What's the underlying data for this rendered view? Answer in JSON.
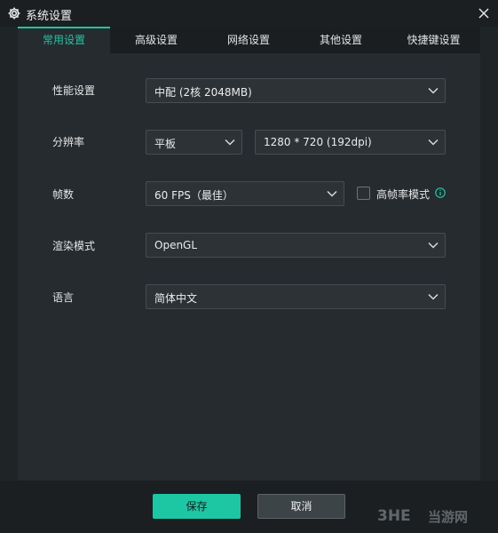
{
  "window": {
    "title": "系统设置",
    "icon": "gear-icon",
    "close_icon": "close-icon"
  },
  "tabs": [
    {
      "label": "常用设置",
      "active": true
    },
    {
      "label": "高级设置",
      "active": false
    },
    {
      "label": "网络设置",
      "active": false
    },
    {
      "label": "其他设置",
      "active": false
    },
    {
      "label": "快捷键设置",
      "active": false
    }
  ],
  "settings": {
    "performance": {
      "label": "性能设置",
      "value": "中配 (2核 2048MB)"
    },
    "resolution": {
      "label": "分辨率",
      "device": "平板",
      "value": "1280 * 720 (192dpi)"
    },
    "fps": {
      "label": "帧数",
      "value": "60 FPS（最佳）",
      "high_fps_label": "高帧率模式",
      "high_fps_checked": false
    },
    "render": {
      "label": "渲染模式",
      "value": "OpenGL"
    },
    "language": {
      "label": "语言",
      "value": "简体中文"
    }
  },
  "footer": {
    "save_label": "保存",
    "cancel_label": "取消"
  },
  "watermark": {
    "logo_text": "3HE",
    "text": "当游网"
  },
  "colors": {
    "accent": "#1ec7a4",
    "window_bg": "#1b1f22",
    "panel_bg": "#252b2f",
    "field_bg": "#2c3236"
  }
}
